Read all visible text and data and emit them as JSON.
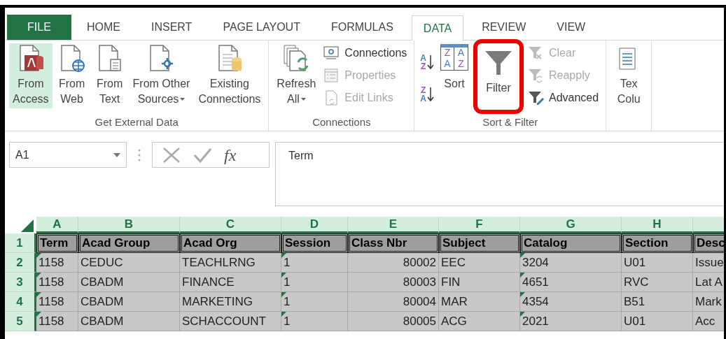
{
  "tabs": [
    {
      "label": "FILE",
      "kind": "file",
      "selected": false
    },
    {
      "label": "HOME",
      "kind": "tab",
      "selected": false
    },
    {
      "label": "INSERT",
      "kind": "tab",
      "selected": false
    },
    {
      "label": "PAGE LAYOUT",
      "kind": "tab",
      "selected": false
    },
    {
      "label": "FORMULAS",
      "kind": "tab",
      "selected": false
    },
    {
      "label": "DATA",
      "kind": "tab",
      "selected": true
    },
    {
      "label": "REVIEW",
      "kind": "tab",
      "selected": false
    },
    {
      "label": "VIEW",
      "kind": "tab",
      "selected": false
    }
  ],
  "ribbon": {
    "groups": [
      {
        "label": "Get External Data",
        "items": [
          {
            "kind": "large",
            "lines": [
              "From",
              "Access"
            ],
            "selected": true,
            "dropdown": false
          },
          {
            "kind": "large",
            "lines": [
              "From",
              "Web"
            ],
            "selected": false,
            "dropdown": false
          },
          {
            "kind": "large",
            "lines": [
              "From",
              "Text"
            ],
            "selected": false,
            "dropdown": false
          },
          {
            "kind": "large",
            "lines": [
              "From Other",
              "Sources"
            ],
            "selected": false,
            "dropdown": true
          },
          {
            "kind": "large",
            "lines": [
              "Existing",
              "Connections"
            ],
            "selected": false,
            "dropdown": false
          }
        ]
      },
      {
        "label": "Connections",
        "items": [
          {
            "kind": "large",
            "lines": [
              "Refresh",
              "All"
            ],
            "selected": false,
            "dropdown": true
          },
          {
            "kind": "stack",
            "buttons": [
              {
                "label": "Connections",
                "disabled": false
              },
              {
                "label": "Properties",
                "disabled": true
              },
              {
                "label": "Edit Links",
                "disabled": true
              }
            ]
          }
        ]
      },
      {
        "label": "Sort & Filter",
        "items": [
          {
            "kind": "stack",
            "buttons": [
              {
                "letters": [
                  "A",
                  "Z"
                ],
                "disabled": false
              },
              {
                "letters": [
                  "Z",
                  "A"
                ],
                "disabled": false
              }
            ]
          },
          {
            "kind": "large",
            "lines": [
              "Sort"
            ],
            "icon_letters": [
              "Z",
              "A",
              "A",
              "Z"
            ],
            "selected": false,
            "dropdown": false
          },
          {
            "kind": "large",
            "lines": [
              "Filter"
            ],
            "selected": false,
            "dropdown": false,
            "highlighted": true
          },
          {
            "kind": "stack",
            "buttons": [
              {
                "label": "Clear",
                "disabled": true
              },
              {
                "label": "Reapply",
                "disabled": true
              },
              {
                "label": "Advanced",
                "disabled": false
              }
            ]
          }
        ]
      },
      {
        "items": [
          {
            "kind": "large",
            "lines": [
              "Tex",
              "Colu"
            ],
            "selected": false,
            "dropdown": false
          }
        ]
      }
    ]
  },
  "formula_bar": {
    "name_box": "A1",
    "function_label": "fx",
    "formula": "Term"
  },
  "sheet": {
    "columns": [
      {
        "letter": "A",
        "header": "Term",
        "kind": "text"
      },
      {
        "letter": "B",
        "header": "Acad Group",
        "kind": "text"
      },
      {
        "letter": "C",
        "header": "Acad Org",
        "kind": "text"
      },
      {
        "letter": "D",
        "header": "Session",
        "kind": "text"
      },
      {
        "letter": "E",
        "header": "Class Nbr",
        "kind": "number"
      },
      {
        "letter": "F",
        "header": "Subject",
        "kind": "text"
      },
      {
        "letter": "G",
        "header": "Catalog",
        "kind": "text"
      },
      {
        "letter": "H",
        "header": "Section",
        "kind": "text"
      },
      {
        "header": "Desc",
        "kind": "text"
      }
    ],
    "header_row": "1",
    "rows": [
      {
        "number": "2",
        "cells": [
          {
            "text": "1158",
            "flagged": true
          },
          {
            "text": "CEDUC",
            "flagged": false
          },
          {
            "text": "TEACHLRNG",
            "flagged": false
          },
          {
            "text": "1",
            "flagged": true
          },
          {
            "text": "80002",
            "flagged": false
          },
          {
            "text": "EEC",
            "flagged": false
          },
          {
            "text": "3204",
            "flagged": true
          },
          {
            "text": "U01",
            "flagged": false
          },
          {
            "text": "Issue",
            "flagged": false
          }
        ]
      },
      {
        "number": "3",
        "cells": [
          {
            "text": "1158",
            "flagged": true
          },
          {
            "text": "CBADM",
            "flagged": false
          },
          {
            "text": "FINANCE",
            "flagged": false
          },
          {
            "text": "1",
            "flagged": true
          },
          {
            "text": "80003",
            "flagged": false
          },
          {
            "text": "FIN",
            "flagged": false
          },
          {
            "text": "4651",
            "flagged": true
          },
          {
            "text": "RVC",
            "flagged": false
          },
          {
            "text": "Lat A",
            "flagged": false
          }
        ]
      },
      {
        "number": "4",
        "cells": [
          {
            "text": "1158",
            "flagged": true
          },
          {
            "text": "CBADM",
            "flagged": false
          },
          {
            "text": "MARKETING",
            "flagged": false
          },
          {
            "text": "1",
            "flagged": true
          },
          {
            "text": "80004",
            "flagged": false
          },
          {
            "text": "MAR",
            "flagged": false
          },
          {
            "text": "4354",
            "flagged": true
          },
          {
            "text": "B51",
            "flagged": false
          },
          {
            "text": "Mark",
            "flagged": false
          }
        ]
      },
      {
        "number": "5",
        "cells": [
          {
            "text": "1158",
            "flagged": true
          },
          {
            "text": "CBADM",
            "flagged": false
          },
          {
            "text": "SCHACCOUNT",
            "flagged": false
          },
          {
            "text": "1",
            "flagged": true
          },
          {
            "text": "80005",
            "flagged": false
          },
          {
            "text": "ACG",
            "flagged": false
          },
          {
            "text": "2021",
            "flagged": true
          },
          {
            "text": "U01",
            "flagged": false
          },
          {
            "text": "Acc",
            "flagged": false
          }
        ]
      }
    ]
  }
}
